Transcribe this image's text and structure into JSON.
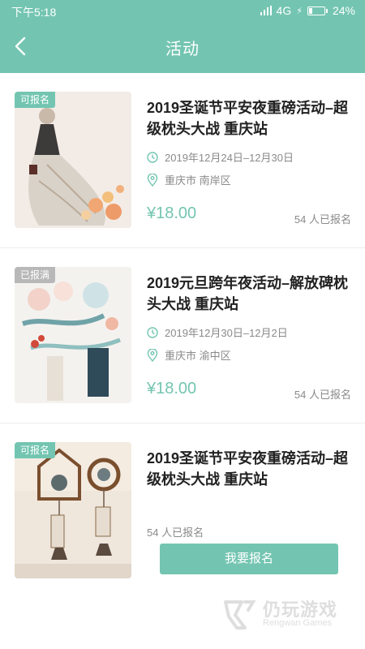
{
  "status_bar": {
    "time": "下午5:18",
    "network": "4G",
    "battery": "24%",
    "battery_level": 0.24
  },
  "header": {
    "title": "活动",
    "back_icon": "chevron-left-icon",
    "background": "#73c5b1"
  },
  "activities": [
    {
      "tag": "可报名",
      "tag_status": "open",
      "title": "2019圣诞节平安夜重磅活动–超级枕头大战 重庆站",
      "date": "2019年12月24日–12月30日",
      "location": "重庆市 南岸区",
      "price": "¥18.00",
      "enrolled": "54 人已报名"
    },
    {
      "tag": "已报满",
      "tag_status": "full",
      "title": "2019元旦跨年夜活动–解放碑枕头大战 重庆站",
      "date": "2019年12月30日–12月2日",
      "location": "重庆市 渝中区",
      "price": "¥18.00",
      "enrolled": "54 人已报名"
    },
    {
      "tag": "可报名",
      "tag_status": "open",
      "title": "2019圣诞节平安夜重磅活动–超级枕头大战 重庆站",
      "enrolled": "54 人已报名",
      "button": "我要报名"
    }
  ],
  "watermark": {
    "text": "仍玩游戏",
    "sub": "Rengwan Games"
  },
  "colors": {
    "accent": "#73c5b1",
    "tag_full": "#b8b8b8",
    "muted_text": "#8a8a8a"
  }
}
